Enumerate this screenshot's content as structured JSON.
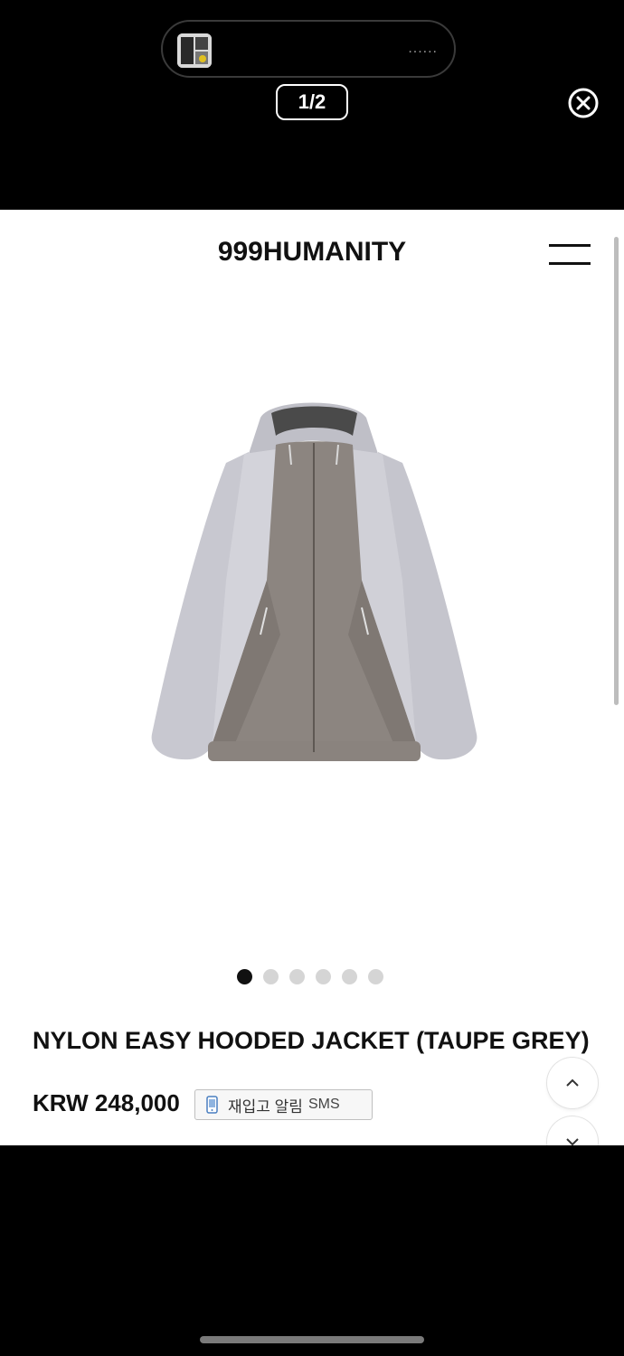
{
  "viewer": {
    "counter": "1/2",
    "dots": "......",
    "close_icon": "close-circle-icon"
  },
  "page": {
    "brand": "999HUMANITY",
    "menu_icon": "hamburger-menu-icon",
    "product_image": "product-image-jacket",
    "carousel": {
      "total": 6,
      "active_index": 0
    },
    "product_title": "NYLON EASY HOODED JACKET (TAUPE GREY)",
    "price": "KRW 248,000",
    "restock": {
      "label": "재입고 알림",
      "sms": "SMS"
    },
    "scroll_up_icon": "chevron-up-icon",
    "scroll_down_icon": "chevron-down-icon"
  }
}
